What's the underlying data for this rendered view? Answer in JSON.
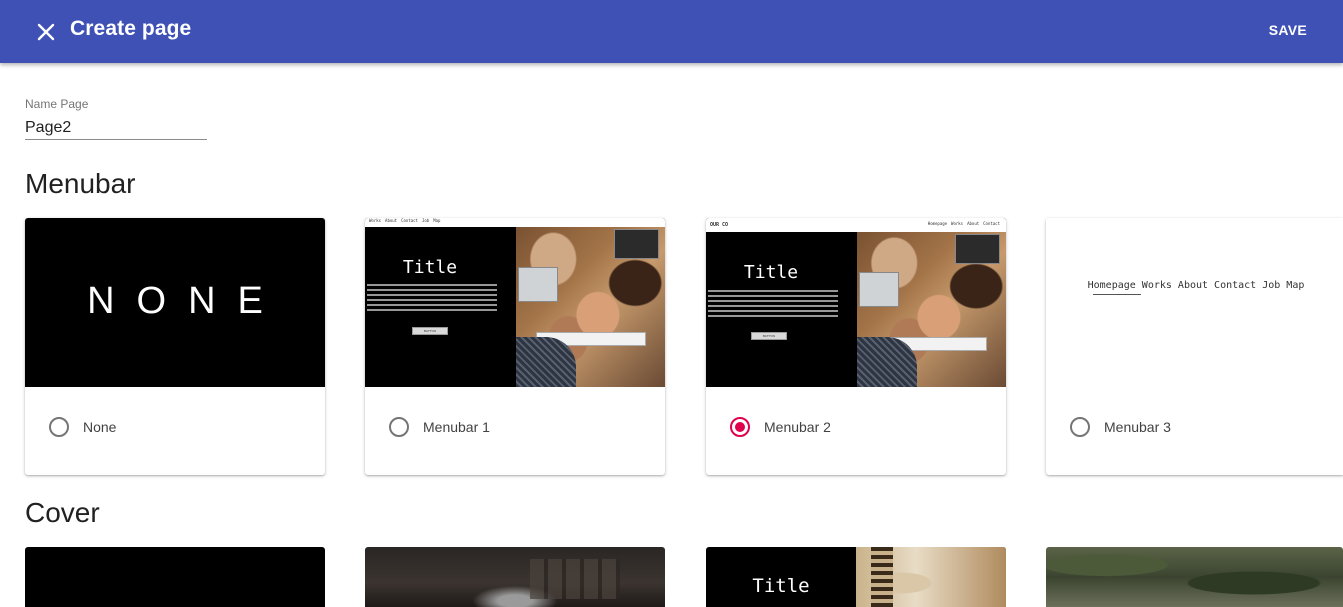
{
  "appbar": {
    "title": "Create page",
    "save_label": "SAVE",
    "color": "#3f51b5"
  },
  "name_field": {
    "label": "Name Page",
    "value": "Page2"
  },
  "sections": {
    "menubar": "Menubar",
    "cover": "Cover"
  },
  "menubar_options": [
    {
      "label": "None",
      "preview_text": "NONE",
      "selected": false
    },
    {
      "label": "Menubar 1",
      "preview_title": "Title",
      "preview_button": "BUTTON",
      "selected": false
    },
    {
      "label": "Menubar 2",
      "preview_title": "Title",
      "preview_button": "BUTTON",
      "preview_logo": "OUR CO",
      "selected": true
    },
    {
      "label": "Menubar 3",
      "preview_links": "Homepage Works About Contact Job Map",
      "selected": false
    }
  ],
  "mini_nav_1": [
    "Works",
    "About",
    "Contact",
    "Job",
    "Map"
  ],
  "mini_nav_2": [
    "Homepage",
    "Works",
    "About",
    "Contact"
  ],
  "cover_preview": {
    "title": "Title"
  },
  "accent_color": "#e0004d"
}
